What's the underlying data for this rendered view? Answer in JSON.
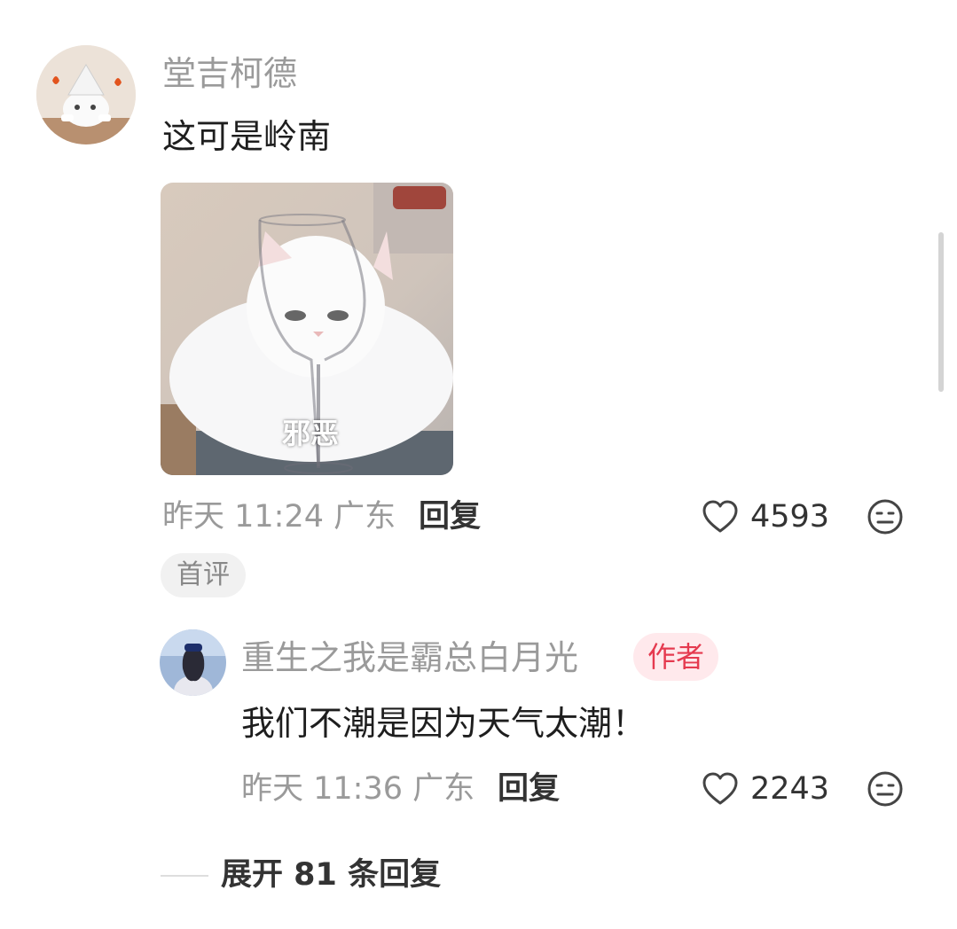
{
  "comment": {
    "username": "堂吉柯德",
    "text": "这可是岭南",
    "image_caption": "邪恶",
    "time": "昨天 11:24",
    "location": "广东",
    "reply_label": "回复",
    "likes": "4593",
    "first_badge": "首评"
  },
  "reply": {
    "username": "重生之我是霸总白月光",
    "author_badge": "作者",
    "text": "我们不潮是因为天气太潮！",
    "time": "昨天 11:36",
    "location": "广东",
    "reply_label": "回复",
    "likes": "2243"
  },
  "expand_label": "展开 81 条回复",
  "colors": {
    "muted_text": "#9a9a9a",
    "body_text": "#1e1e1e",
    "author_badge_bg": "#ffe9ec",
    "author_badge_text": "#e53a4f"
  },
  "icons": {
    "like": "heart-outline-icon",
    "emoji": "neutral-face-icon"
  }
}
